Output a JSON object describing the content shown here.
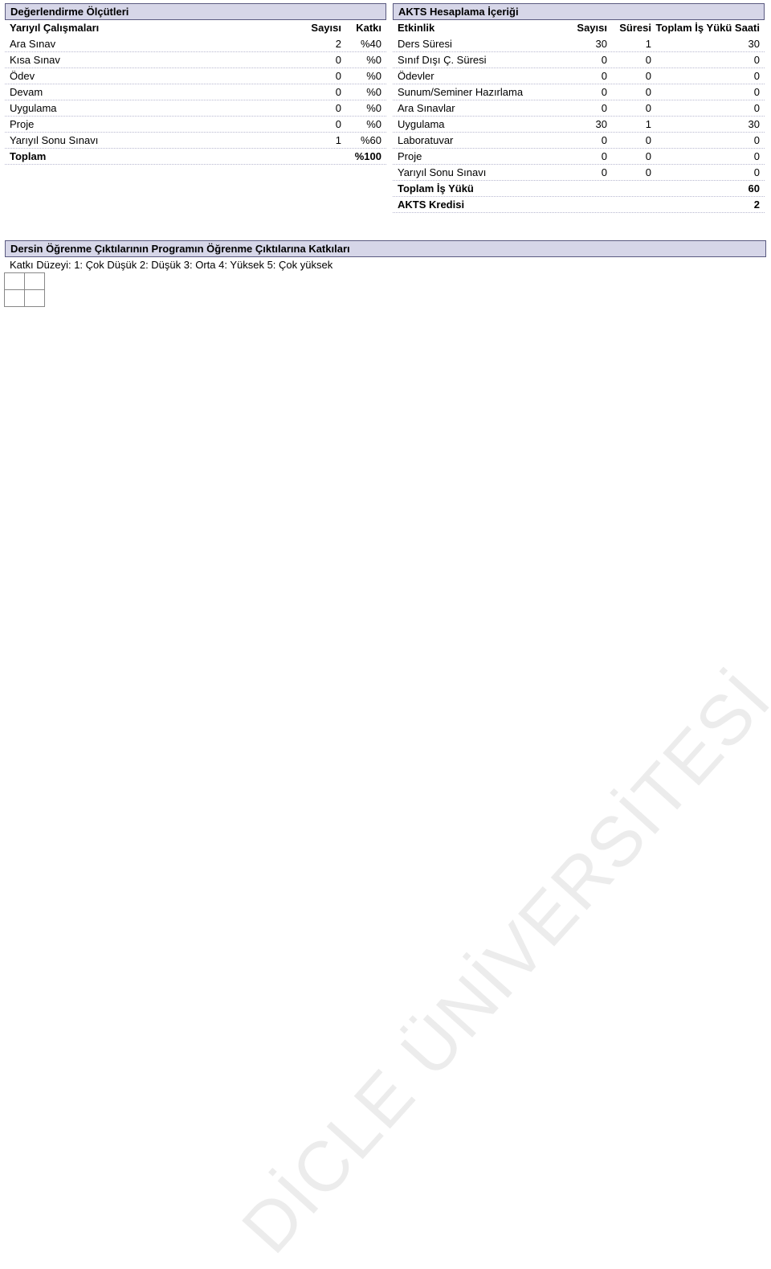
{
  "left": {
    "title": "Değerlendirme Ölçütleri",
    "header": {
      "c1": "Yarıyıl Çalışmaları",
      "c2": "Sayısı",
      "c3": "Katkı"
    },
    "rows": [
      {
        "c1": "Ara Sınav",
        "c2": "2",
        "c3": "%40"
      },
      {
        "c1": "Kısa Sınav",
        "c2": "0",
        "c3": "%0"
      },
      {
        "c1": "Ödev",
        "c2": "0",
        "c3": "%0"
      },
      {
        "c1": "Devam",
        "c2": "0",
        "c3": "%0"
      },
      {
        "c1": "Uygulama",
        "c2": "0",
        "c3": "%0"
      },
      {
        "c1": "Proje",
        "c2": "0",
        "c3": "%0"
      },
      {
        "c1": "Yarıyıl Sonu Sınavı",
        "c2": "1",
        "c3": "%60"
      }
    ],
    "footer": {
      "c1": "Toplam",
      "c2": "",
      "c3": "%100"
    }
  },
  "right": {
    "title": "AKTS Hesaplama İçeriği",
    "header": {
      "c1": "Etkinlik",
      "c2": "Sayısı",
      "c3": "Süresi",
      "c4": "Toplam İş Yükü Saati"
    },
    "rows": [
      {
        "c1": "Ders Süresi",
        "c2": "30",
        "c3": "1",
        "c4": "30"
      },
      {
        "c1": "Sınıf Dışı Ç. Süresi",
        "c2": "0",
        "c3": "0",
        "c4": "0"
      },
      {
        "c1": "Ödevler",
        "c2": "0",
        "c3": "0",
        "c4": "0"
      },
      {
        "c1": "Sunum/Seminer Hazırlama",
        "c2": "0",
        "c3": "0",
        "c4": "0"
      },
      {
        "c1": "Ara Sınavlar",
        "c2": "0",
        "c3": "0",
        "c4": "0"
      },
      {
        "c1": "Uygulama",
        "c2": "30",
        "c3": "1",
        "c4": "30"
      },
      {
        "c1": "Laboratuvar",
        "c2": "0",
        "c3": "0",
        "c4": "0"
      },
      {
        "c1": "Proje",
        "c2": "0",
        "c3": "0",
        "c4": "0"
      },
      {
        "c1": "Yarıyıl Sonu Sınavı",
        "c2": "0",
        "c3": "0",
        "c4": "0"
      }
    ],
    "footer1": {
      "c1": "Toplam İş Yükü",
      "c4": "60"
    },
    "footer2": {
      "c1": "AKTS Kredisi",
      "c4": "2"
    }
  },
  "outcomes": {
    "title": "Dersin Öğrenme Çıktılarının Programın Öğrenme Çıktılarına Katkıları",
    "note": "Katkı Düzeyi: 1: Çok Düşük 2: Düşük 3: Orta 4: Yüksek 5: Çok yüksek"
  },
  "watermark": "DİCLE ÜNİVERSİTESİ"
}
